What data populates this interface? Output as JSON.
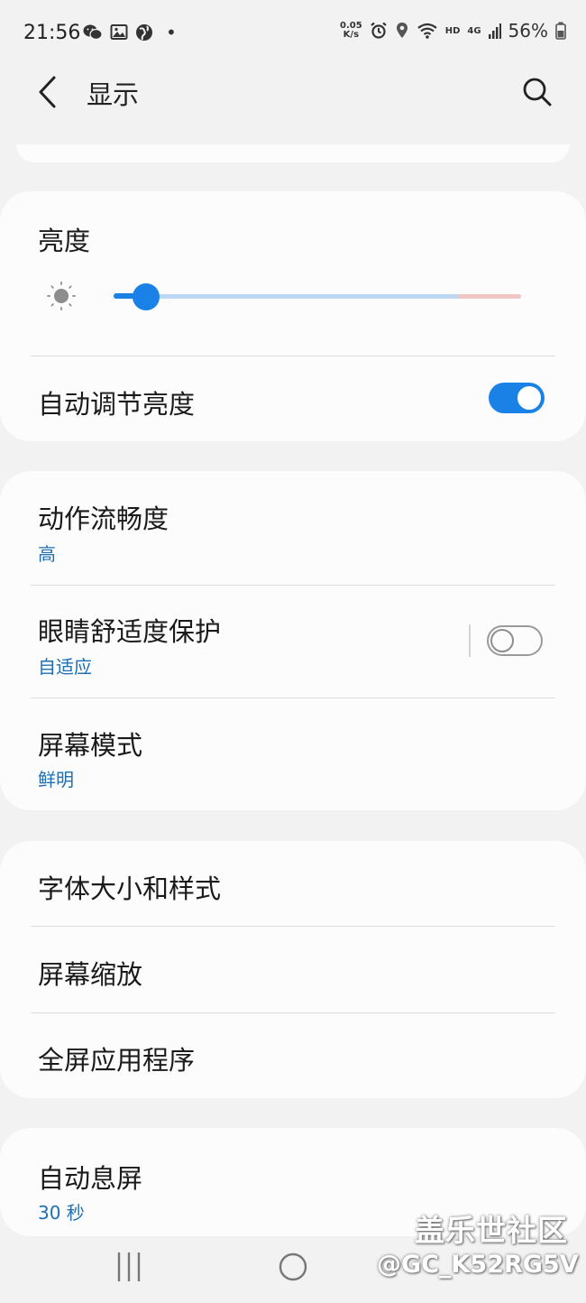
{
  "status_bar": {
    "time": "21:56",
    "net_speed_top": "0.05",
    "net_speed_bottom": "K/s",
    "hd": "HD",
    "network": "4G",
    "battery": "56%",
    "dot": "•"
  },
  "header": {
    "title": "显示",
    "back_icon": "chevron-left-icon",
    "search_icon": "search-icon"
  },
  "brightness_card": {
    "title": "亮度",
    "level": 0.08,
    "auto_label": "自动调节亮度",
    "auto_on": true
  },
  "display_card": {
    "items": [
      {
        "title": "动作流畅度",
        "value": "高"
      },
      {
        "title": "眼睛舒适度保护",
        "value": "自适应",
        "toggle_on": false
      },
      {
        "title": "屏幕模式",
        "value": "鲜明"
      }
    ]
  },
  "font_card": {
    "items": [
      {
        "title": "字体大小和样式"
      },
      {
        "title": "屏幕缩放"
      },
      {
        "title": "全屏应用程序"
      }
    ]
  },
  "timeout_card": {
    "title": "自动息屏",
    "value": "30 秒"
  },
  "watermark": {
    "line1": "盖乐世社区",
    "line2": "@GC_K52RG5V"
  },
  "colors": {
    "accent": "#1a82e6",
    "subtext": "#1e6fb3",
    "background": "#f2f2f2",
    "card": "#fcfcfc"
  }
}
